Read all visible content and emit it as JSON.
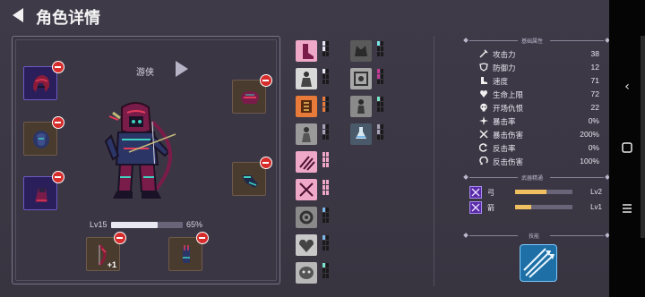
{
  "header": {
    "title": "角色详情"
  },
  "character": {
    "class_name": "游侠",
    "level_label": "Lv15",
    "xp_percent": "65%",
    "xp_fraction": 0.65
  },
  "equipment": {
    "slots": [
      {
        "name": "helmet",
        "plus": ""
      },
      {
        "name": "chest",
        "plus": ""
      },
      {
        "name": "gloves",
        "plus": ""
      },
      {
        "name": "cloak",
        "plus": ""
      },
      {
        "name": "boots",
        "plus": ""
      },
      {
        "name": "bow",
        "plus": "+1"
      },
      {
        "name": "arrow",
        "plus": ""
      }
    ]
  },
  "stats_section": {
    "title": "基础属性"
  },
  "stats": [
    {
      "label": "攻击力",
      "value": "38",
      "icon": "sword-icon"
    },
    {
      "label": "防御力",
      "value": "12",
      "icon": "shield-icon"
    },
    {
      "label": "速度",
      "value": "71",
      "icon": "boot-icon"
    },
    {
      "label": "生命上限",
      "value": "72",
      "icon": "heart-icon"
    },
    {
      "label": "开场仇恨",
      "value": "22",
      "icon": "skull-icon"
    },
    {
      "label": "暴击率",
      "value": "0%",
      "icon": "crit-icon"
    },
    {
      "label": "暴击伤害",
      "value": "200%",
      "icon": "crit-damage-icon"
    },
    {
      "label": "反击率",
      "value": "0%",
      "icon": "counter-icon"
    },
    {
      "label": "反击伤害",
      "value": "100%",
      "icon": "counter-damage-icon"
    }
  ],
  "weapon_section": {
    "title": "武器精通"
  },
  "weapons": [
    {
      "label": "弓",
      "level": "Lv2",
      "progress": 0.55
    },
    {
      "label": "箭",
      "level": "Lv1",
      "progress": 0.28
    }
  ],
  "skill_section": {
    "title": "技能"
  },
  "colors": {
    "accent": "#f0c060",
    "remove": "#d62c2c",
    "rare": "#6b5ac2"
  }
}
